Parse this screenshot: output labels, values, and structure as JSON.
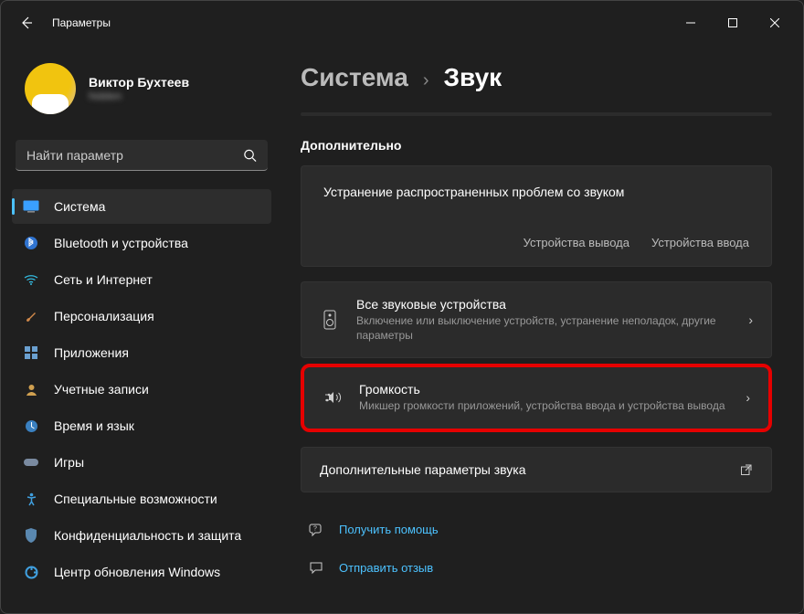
{
  "window": {
    "title": "Параметры"
  },
  "user": {
    "name": "Виктор Бухтеев",
    "email": "hidden"
  },
  "search": {
    "placeholder": "Найти параметр"
  },
  "nav": {
    "items": [
      {
        "label": "Система"
      },
      {
        "label": "Bluetooth и устройства"
      },
      {
        "label": "Сеть и Интернет"
      },
      {
        "label": "Персонализация"
      },
      {
        "label": "Приложения"
      },
      {
        "label": "Учетные записи"
      },
      {
        "label": "Время и язык"
      },
      {
        "label": "Игры"
      },
      {
        "label": "Специальные возможности"
      },
      {
        "label": "Конфиденциальность и защита"
      },
      {
        "label": "Центр обновления Windows"
      }
    ]
  },
  "breadcrumb": {
    "root": "Система",
    "leaf": "Звук"
  },
  "section": {
    "more": "Дополнительно"
  },
  "troubleshoot": {
    "title": "Устранение распространенных проблем со звуком",
    "output": "Устройства вывода",
    "input": "Устройства ввода"
  },
  "rows": {
    "all_devices": {
      "title": "Все звуковые устройства",
      "sub": "Включение или выключение устройств, устранение неполадок, другие параметры"
    },
    "volume": {
      "title": "Громкость",
      "sub": "Микшер громкости приложений, устройства ввода и устройства вывода"
    },
    "more_sound": {
      "title": "Дополнительные параметры звука"
    }
  },
  "help": {
    "get_help": "Получить помощь",
    "feedback": "Отправить отзыв"
  }
}
